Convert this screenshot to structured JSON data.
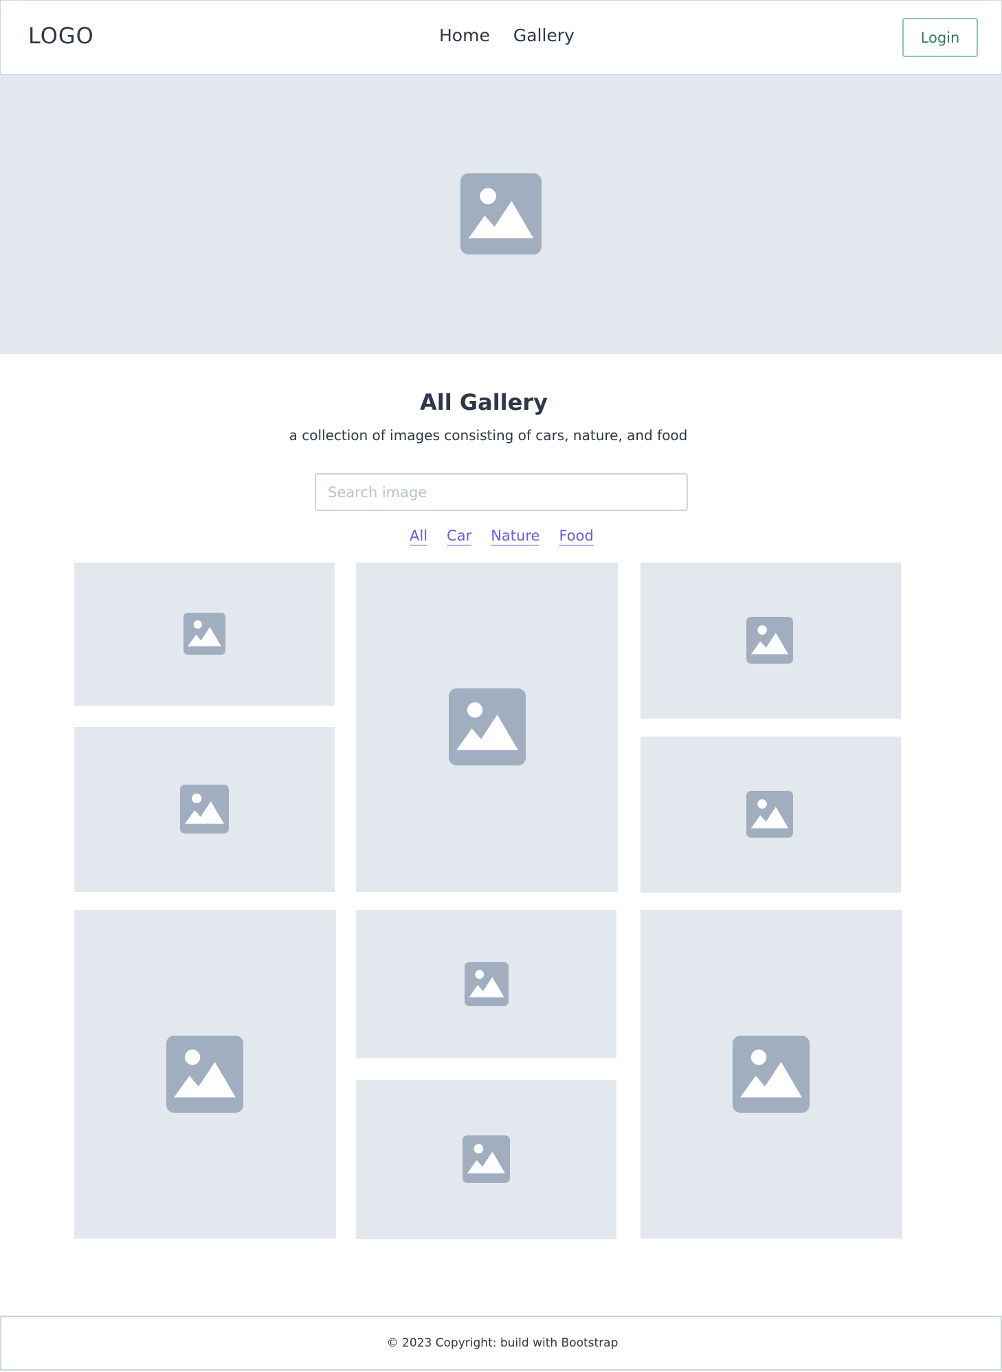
{
  "navbar": {
    "logo": "LOGO",
    "links": [
      {
        "label": "Home"
      },
      {
        "label": "Gallery"
      }
    ],
    "login_label": "Login"
  },
  "gallery": {
    "title": "All Gallery",
    "subtitle": "a collection of images consisting of cars, nature, and food",
    "search_placeholder": "Search image",
    "search_value": "",
    "filters": [
      {
        "label": "All"
      },
      {
        "label": "Car"
      },
      {
        "label": "Nature"
      },
      {
        "label": "Food"
      }
    ]
  },
  "footer": {
    "copyright": "© 2023 Copyright: build with Bootstrap"
  },
  "icons": {
    "image_placeholder": "image-icon"
  },
  "colors": {
    "placeholder_bg": "#e2e8ed",
    "icon": "#a0aec0",
    "login_text": "#2c7a67",
    "filter_link": "#6b5ce7"
  }
}
